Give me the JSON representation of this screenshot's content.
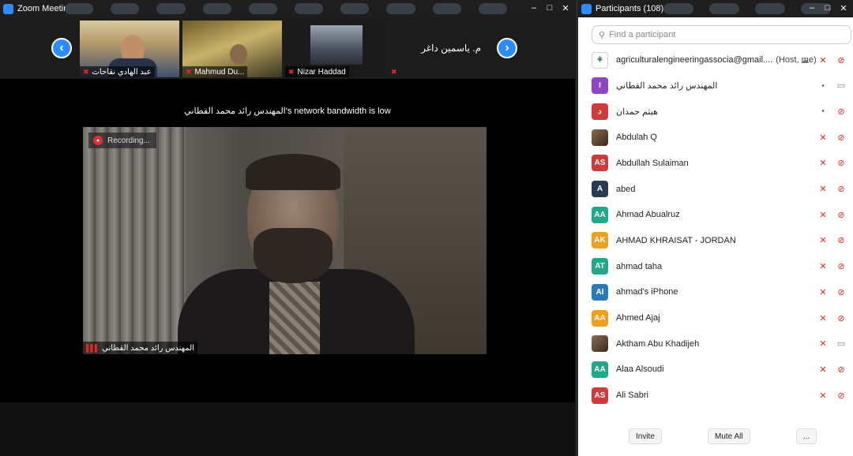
{
  "meeting": {
    "title": "Zoom Meeting",
    "thumbnails": [
      {
        "name": "عبد الهادي نقاحات"
      },
      {
        "name": "Mahmud Du..."
      },
      {
        "name": "Nizar Haddad"
      },
      {
        "name": "م. ياسمين داغر"
      }
    ],
    "bandwidth_notice": "المهندس رائد محمد القطاني's network bandwidth is low",
    "recording_label": "Recording...",
    "speaker_name": "المهندس رائد محمد القطاني"
  },
  "participants": {
    "title": "Participants (108)",
    "search_placeholder": "Find a participant",
    "list": [
      {
        "initials": "",
        "color": "#ffffff",
        "name": "agriculturalengineeringassocia@gmail....",
        "role": "(Host, me)",
        "mic": "muted",
        "cam": "off",
        "avatar": "logo"
      },
      {
        "initials": "I",
        "color": "#8e44c4",
        "name": "المهندس رائد محمد القطاني",
        "role": "",
        "mic": "on",
        "cam": "on",
        "avatar": "initials"
      },
      {
        "initials": "د",
        "color": "#d03a3a",
        "name": "هيثم حمدان",
        "role": "",
        "mic": "on",
        "cam": "off",
        "avatar": "initials"
      },
      {
        "initials": "",
        "color": "#7a5a40",
        "name": "Abdulah Q",
        "role": "",
        "mic": "muted",
        "cam": "off",
        "avatar": "photo"
      },
      {
        "initials": "AS",
        "color": "#d03a3a",
        "name": "Abdullah Sulaiman",
        "role": "",
        "mic": "muted",
        "cam": "off",
        "avatar": "initials"
      },
      {
        "initials": "A",
        "color": "#2a3a52",
        "name": "abed",
        "role": "",
        "mic": "muted",
        "cam": "off",
        "avatar": "initials"
      },
      {
        "initials": "AA",
        "color": "#1fa88a",
        "name": "Ahmad Abualruz",
        "role": "",
        "mic": "muted",
        "cam": "off",
        "avatar": "initials"
      },
      {
        "initials": "AK",
        "color": "#f0a020",
        "name": "AHMAD KHRAISAT - JORDAN",
        "role": "",
        "mic": "muted",
        "cam": "off",
        "avatar": "initials"
      },
      {
        "initials": "AT",
        "color": "#1fa88a",
        "name": "ahmad taha",
        "role": "",
        "mic": "muted",
        "cam": "off",
        "avatar": "initials"
      },
      {
        "initials": "AI",
        "color": "#2a7ab8",
        "name": "ahmad's iPhone",
        "role": "",
        "mic": "muted",
        "cam": "off",
        "avatar": "initials"
      },
      {
        "initials": "AA",
        "color": "#f0a020",
        "name": "Ahmed Ajaj",
        "role": "",
        "mic": "muted",
        "cam": "off",
        "avatar": "initials"
      },
      {
        "initials": "",
        "color": "#5a3a2a",
        "name": "Aktham Abu Khadijeh",
        "role": "",
        "mic": "muted",
        "cam": "on",
        "avatar": "photo"
      },
      {
        "initials": "AA",
        "color": "#1fa88a",
        "name": "Alaa Alsoudi",
        "role": "",
        "mic": "muted",
        "cam": "off",
        "avatar": "initials"
      },
      {
        "initials": "AS",
        "color": "#d03a3a",
        "name": "Ali Sabri",
        "role": "",
        "mic": "muted",
        "cam": "off",
        "avatar": "initials"
      }
    ],
    "footer": {
      "invite": "Invite",
      "mute_all": "Mute All",
      "more": "..."
    }
  },
  "colors": {
    "accent": "#2d8cff",
    "muted_red": "#e02828"
  }
}
